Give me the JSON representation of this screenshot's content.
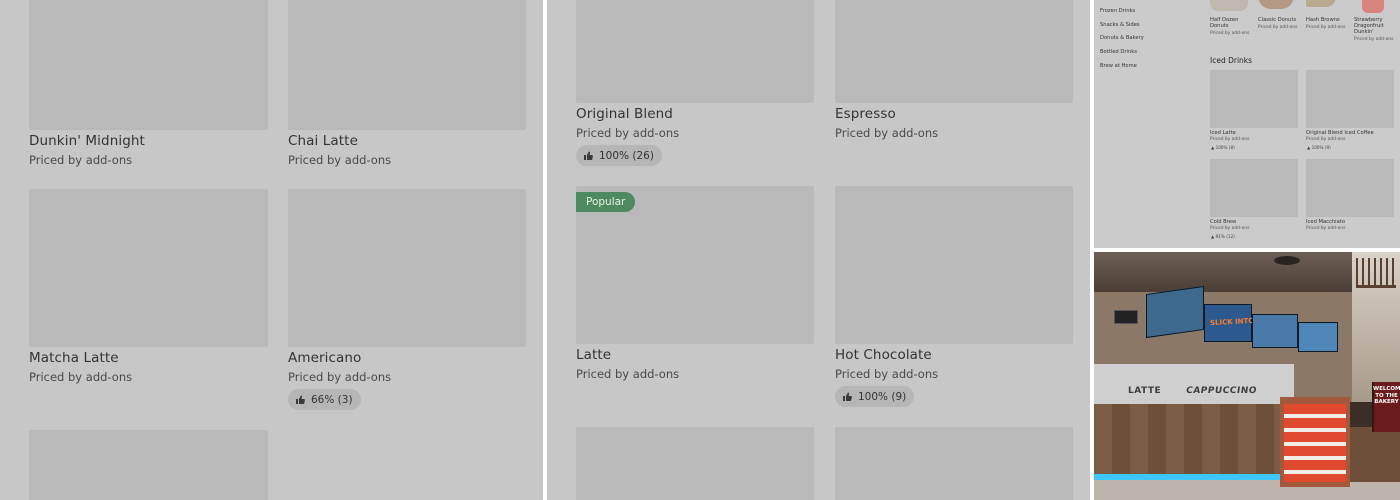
{
  "left_panel": {
    "items": [
      {
        "name": "Dunkin' Midnight",
        "price": "Priced by add-ons",
        "rating": ""
      },
      {
        "name": "Chai Latte",
        "price": "Priced by add-ons",
        "rating": ""
      },
      {
        "name": "Matcha Latte",
        "price": "Priced by add-ons",
        "rating": ""
      },
      {
        "name": "Americano",
        "price": "Priced by add-ons",
        "rating": "66% (3)"
      }
    ]
  },
  "mid_panel": {
    "items": [
      {
        "name": "Original Blend",
        "price": "Priced by add-ons",
        "rating": "100% (26)"
      },
      {
        "name": "Espresso",
        "price": "Priced by add-ons",
        "rating": ""
      },
      {
        "name": "Latte",
        "price": "Priced by add-ons",
        "rating": "",
        "badge": "Popular"
      },
      {
        "name": "Hot Chocolate",
        "price": "Priced by add-ons",
        "rating": "100% (9)"
      }
    ]
  },
  "right_panel": {
    "categories": [
      "Frozen Drinks",
      "Snacks & Sides",
      "Donuts & Bakery",
      "Bottled Drinks",
      "Brew at Home"
    ],
    "top_items": [
      {
        "name": "Half Dozen Donuts",
        "price": "Priced by add-ons"
      },
      {
        "name": "Classic Donuts",
        "price": "Priced by add-ons"
      },
      {
        "name": "Hash Browns",
        "price": "Priced by add-ons"
      },
      {
        "name": "Strawberry Dragonfruit Dunkin'",
        "price": "Priced by add-ons"
      }
    ],
    "section_title": "Iced Drinks",
    "iced_items": [
      {
        "name": "Iced Latte",
        "price": "Priced by add-ons",
        "rating": "100% (8)"
      },
      {
        "name": "Original Blend Iced Coffee",
        "price": "Priced by add-ons",
        "rating": "100% (9)"
      },
      {
        "name": "Cold Brew",
        "price": "Priced by add-ons",
        "rating": "91% (12)"
      },
      {
        "name": "Iced Macchiato",
        "price": "Priced by add-ons",
        "rating": ""
      }
    ]
  },
  "photo": {
    "counter_left": "LATTE",
    "counter_right": "CAPPUCCINO",
    "promo": "SLICK INTO",
    "welcome": "WELCOME TO THE BAKERY"
  },
  "colors": {
    "overlay": "#c7c7c7",
    "thumbnail": "#b9b9b9",
    "popular_badge": "#4e8a5f",
    "divider": "#ffffff"
  },
  "icons": {
    "rating": "thumbs-up-icon"
  }
}
